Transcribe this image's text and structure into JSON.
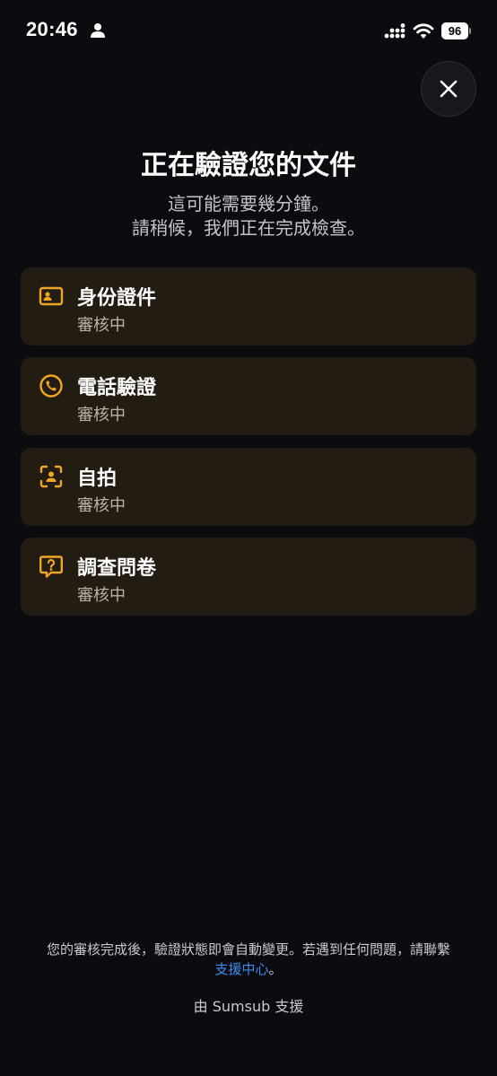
{
  "status_bar": {
    "time": "20:46",
    "battery_level": "96"
  },
  "header": {
    "title": "正在驗證您的文件",
    "subtitle_line1": "這可能需要幾分鐘。",
    "subtitle_line2": "請稍候，我們正在完成檢查。"
  },
  "steps": [
    {
      "title": "身份證件",
      "status": "審核中",
      "icon": "id-card-icon"
    },
    {
      "title": "電話驗證",
      "status": "審核中",
      "icon": "phone-icon"
    },
    {
      "title": "自拍",
      "status": "審核中",
      "icon": "face-scan-icon"
    },
    {
      "title": "調查問卷",
      "status": "審核中",
      "icon": "question-bubble-icon"
    }
  ],
  "footer": {
    "notice": "您的審核完成後，驗證狀態即會自動變更。若遇到任何問題，請聯繫",
    "support_link": "支援中心",
    "notice_end": "。",
    "powered_by": "由 Sumsub 支援"
  },
  "colors": {
    "background": "#0b0b10",
    "card_background": "#231c12",
    "accent": "#f0a624",
    "link": "#3b8ef0"
  }
}
